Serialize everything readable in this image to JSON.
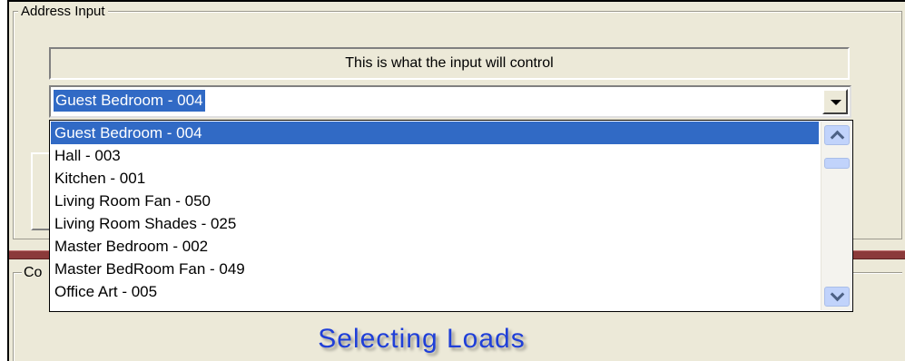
{
  "group_address": {
    "label": "Address Input"
  },
  "control_header": {
    "text": "This is what the input will control"
  },
  "combo": {
    "selected_value": "Guest Bedroom - 004"
  },
  "dropdown": {
    "items": [
      {
        "label": "Guest Bedroom - 004",
        "selected": true
      },
      {
        "label": "Hall - 003",
        "selected": false
      },
      {
        "label": "Kitchen - 001",
        "selected": false
      },
      {
        "label": "Living Room Fan - 050",
        "selected": false
      },
      {
        "label": "Living Room Shades - 025",
        "selected": false
      },
      {
        "label": "Master Bedroom - 002",
        "selected": false
      },
      {
        "label": "Master BedRoom Fan - 049",
        "selected": false
      },
      {
        "label": "Office Art - 005",
        "selected": false
      }
    ]
  },
  "group_second": {
    "label_visible": "Co"
  },
  "caption": {
    "text": "Selecting Loads"
  },
  "colors": {
    "selection": "#316ac5",
    "separator": "#8b3a3a",
    "caption": "#1f3fd8",
    "window_bg": "#ece9d8"
  }
}
